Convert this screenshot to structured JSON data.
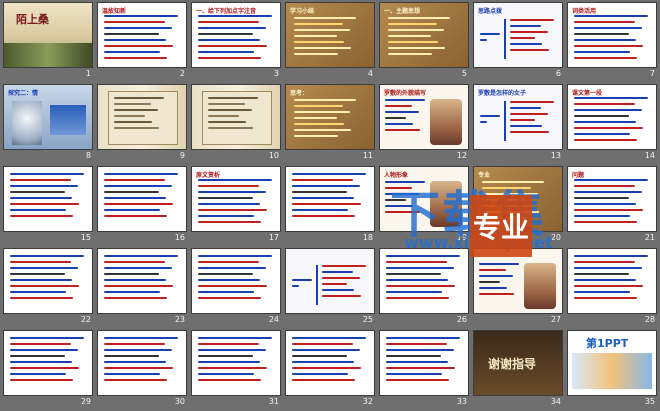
{
  "slides": [
    {
      "n": "1",
      "title": "陌上桑",
      "kind": "cover"
    },
    {
      "n": "2",
      "title": "温故知新",
      "kind": "list"
    },
    {
      "n": "3",
      "title": "一、给下列加点字注音",
      "kind": "list"
    },
    {
      "n": "4",
      "title": "学习小结",
      "kind": "brown"
    },
    {
      "n": "5",
      "title": "一、主题思想",
      "kind": "brown"
    },
    {
      "n": "6",
      "title": "思路点拨",
      "kind": "diagram"
    },
    {
      "n": "7",
      "title": "词类活用",
      "kind": "list"
    },
    {
      "n": "8",
      "title": "探究二：情",
      "kind": "photo"
    },
    {
      "n": "9",
      "title": "",
      "kind": "scroll"
    },
    {
      "n": "10",
      "title": "",
      "kind": "scroll"
    },
    {
      "n": "11",
      "title": "思考：",
      "kind": "brown"
    },
    {
      "n": "12",
      "title": "罗敷的外貌描写",
      "kind": "figure"
    },
    {
      "n": "13",
      "title": "罗敷是怎样的女子",
      "kind": "diagram"
    },
    {
      "n": "14",
      "title": "课文第一段",
      "kind": "list"
    },
    {
      "n": "15",
      "title": "",
      "kind": "list"
    },
    {
      "n": "16",
      "title": "",
      "kind": "list"
    },
    {
      "n": "17",
      "title": "原文赏析",
      "kind": "list"
    },
    {
      "n": "18",
      "title": "",
      "kind": "list"
    },
    {
      "n": "19",
      "title": "人物形象",
      "kind": "figure"
    },
    {
      "n": "20",
      "title": "专业",
      "kind": "brown"
    },
    {
      "n": "21",
      "title": "问题",
      "kind": "list"
    },
    {
      "n": "22",
      "title": "",
      "kind": "list"
    },
    {
      "n": "23",
      "title": "",
      "kind": "list"
    },
    {
      "n": "24",
      "title": "",
      "kind": "list"
    },
    {
      "n": "25",
      "title": "",
      "kind": "diagram"
    },
    {
      "n": "26",
      "title": "",
      "kind": "list"
    },
    {
      "n": "27",
      "title": "",
      "kind": "figure"
    },
    {
      "n": "28",
      "title": "",
      "kind": "list"
    },
    {
      "n": "29",
      "title": "",
      "kind": "list"
    },
    {
      "n": "30",
      "title": "",
      "kind": "list"
    },
    {
      "n": "31",
      "title": "",
      "kind": "list"
    },
    {
      "n": "32",
      "title": "",
      "kind": "list"
    },
    {
      "n": "33",
      "title": "",
      "kind": "list"
    },
    {
      "n": "34",
      "title": "谢谢指导",
      "kind": "thanks"
    },
    {
      "n": "35",
      "title": "第1PPT",
      "kind": "ad"
    }
  ],
  "watermark": {
    "text": "下载集",
    "url": "www.xiazaiji.net",
    "badge": "专业"
  }
}
